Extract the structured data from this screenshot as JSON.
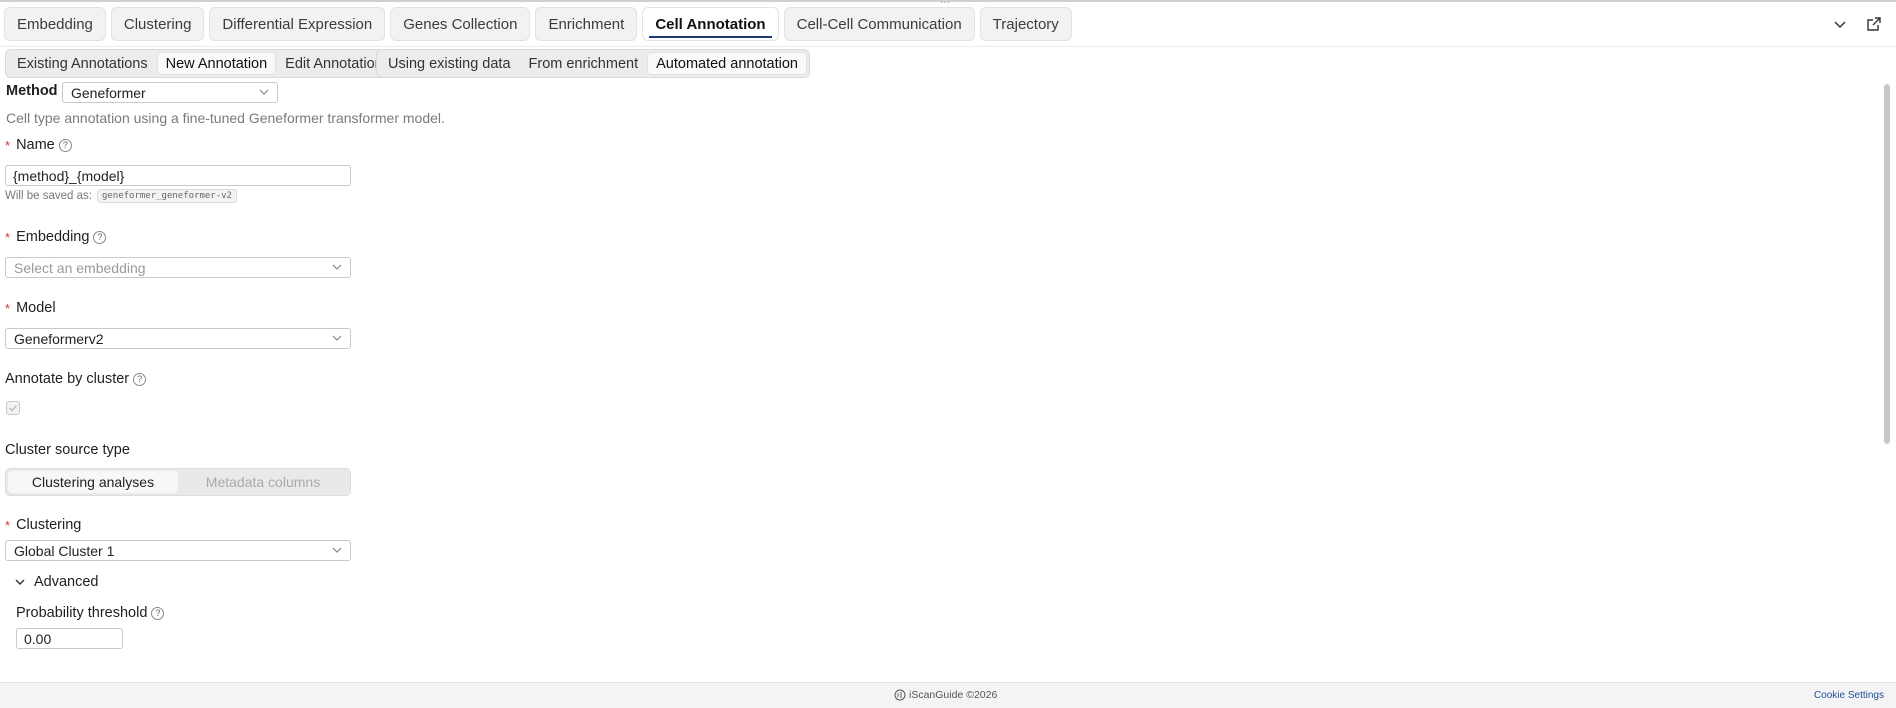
{
  "tabs": [
    {
      "label": "Embedding"
    },
    {
      "label": "Clustering"
    },
    {
      "label": "Differential Expression"
    },
    {
      "label": "Genes Collection"
    },
    {
      "label": "Enrichment"
    },
    {
      "label": "Cell Annotation",
      "active": true
    },
    {
      "label": "Cell-Cell Communication"
    },
    {
      "label": "Trajectory"
    }
  ],
  "top_icons": [
    "chevron-down-icon",
    "external-link-icon"
  ],
  "annotation_modes": [
    {
      "label": "Existing Annotations"
    },
    {
      "label": "New Annotation",
      "selected": true
    },
    {
      "label": "Edit Annotation"
    }
  ],
  "annotation_sources": [
    {
      "label": "Using existing data"
    },
    {
      "label": "From enrichment"
    },
    {
      "label": "Automated annotation",
      "selected": true
    }
  ],
  "form": {
    "method_label": "Method",
    "method_value": "Geneformer",
    "description": "Cell type annotation using a fine-tuned Geneformer transformer model.",
    "name_label": "Name",
    "name_value": "{method}_{model}",
    "saved_as_prefix": "Will be saved as:",
    "saved_as_value": "geneformer_geneformer-v2",
    "embedding_label": "Embedding",
    "embedding_placeholder": "Select an embedding",
    "model_label": "Model",
    "model_value": "Geneformerv2",
    "annotate_by_cluster_label": "Annotate by cluster",
    "annotate_by_cluster_checked": true,
    "cluster_source_label": "Cluster source type",
    "cluster_source_options": [
      {
        "label": "Clustering analyses",
        "selected": true
      },
      {
        "label": "Metadata columns"
      }
    ],
    "clustering_label": "Clustering",
    "clustering_value": "Global Cluster 1",
    "advanced_label": "Advanced",
    "probability_label": "Probability threshold",
    "probability_value": "0.00"
  },
  "footer": {
    "brand": "iScanGuide ©2026",
    "cookie_settings": "Cookie Settings"
  },
  "colors": {
    "accent": "#1f3b73",
    "required": "#d13438",
    "link": "#1f4f9a"
  }
}
